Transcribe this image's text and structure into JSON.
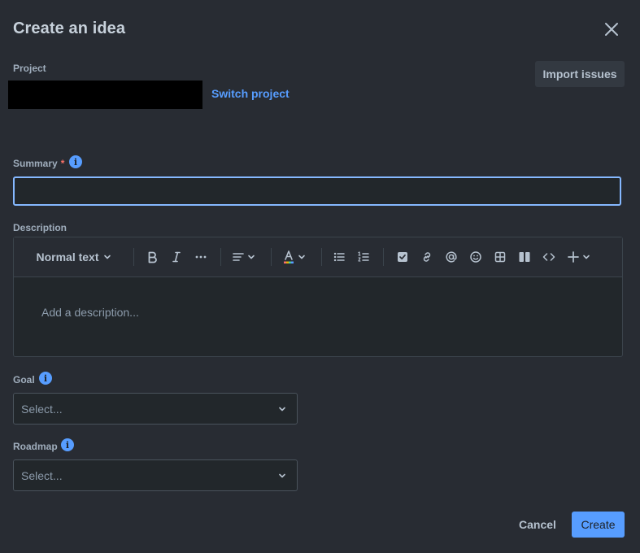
{
  "dialog": {
    "title": "Create an idea"
  },
  "project": {
    "label": "Project",
    "switch_label": "Switch project",
    "import_label": "Import issues"
  },
  "summary": {
    "label": "Summary",
    "required_mark": "*",
    "value": ""
  },
  "description": {
    "label": "Description",
    "text_style": "Normal text",
    "placeholder": "Add a description..."
  },
  "goal": {
    "label": "Goal",
    "select_value": "Select..."
  },
  "roadmap": {
    "label": "Roadmap",
    "select_value": "Select..."
  },
  "footer": {
    "cancel_label": "Cancel",
    "create_label": "Create"
  },
  "icons": {
    "close": "close-icon",
    "info": "info-icon",
    "bold": "bold-icon",
    "italic": "italic-icon",
    "more": "more-icon",
    "align": "align-left-icon",
    "text_color": "text-color-icon",
    "bullet_list": "bullet-list-icon",
    "numbered_list": "numbered-list-icon",
    "action_item": "checkbox-icon",
    "link": "link-icon",
    "mention": "mention-icon",
    "emoji": "emoji-icon",
    "table": "table-icon",
    "layout": "layout-icon",
    "code": "code-icon",
    "insert": "plus-icon",
    "chevron": "chevron-down-icon"
  },
  "colors": {
    "background": "#282c33",
    "accent": "#579dff",
    "focus_border": "#85b8ff",
    "required": "#f87168"
  }
}
